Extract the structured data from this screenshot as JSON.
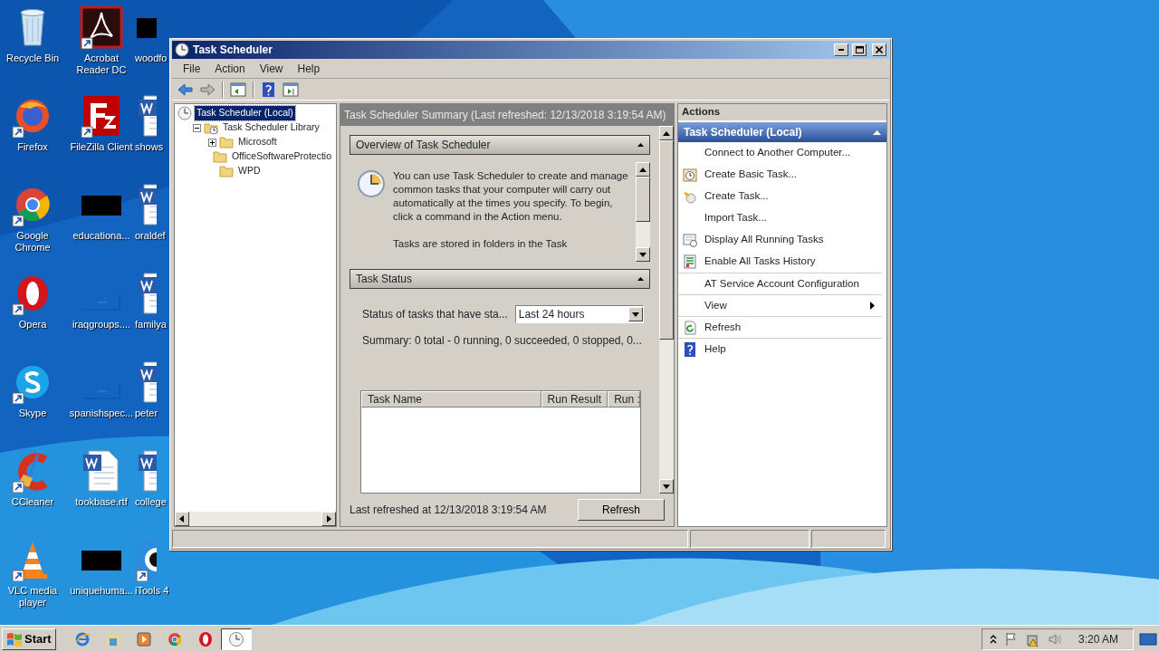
{
  "desktop_icons": [
    {
      "label": "Recycle Bin",
      "kind": "recycle-bin",
      "shortcut": false
    },
    {
      "label": "Firefox",
      "kind": "firefox",
      "shortcut": true
    },
    {
      "label": "Google Chrome",
      "kind": "chrome",
      "shortcut": true
    },
    {
      "label": "Opera",
      "kind": "opera",
      "shortcut": true
    },
    {
      "label": "Skype",
      "kind": "skype",
      "shortcut": true
    },
    {
      "label": "CCleaner",
      "kind": "ccleaner",
      "shortcut": true
    },
    {
      "label": "VLC media player",
      "kind": "vlc",
      "shortcut": true
    },
    {
      "label": "Acrobat Reader DC",
      "kind": "pdf",
      "shortcut": true
    },
    {
      "label": "FileZilla Client",
      "kind": "filezilla",
      "shortcut": true
    },
    {
      "label": "educationa...",
      "kind": "redacted",
      "shortcut": false
    },
    {
      "label": "iraqgroups....",
      "kind": "blank",
      "shortcut": false
    },
    {
      "label": "spanishspec...",
      "kind": "blank",
      "shortcut": false
    },
    {
      "label": "tookbase.rtf",
      "kind": "word",
      "shortcut": false
    },
    {
      "label": "uniquehuma...",
      "kind": "redacted",
      "shortcut": false
    },
    {
      "label": "woodfo",
      "kind": "redacted",
      "shortcut": false
    },
    {
      "label": "shows",
      "kind": "word",
      "shortcut": false
    },
    {
      "label": "oraldef",
      "kind": "word",
      "shortcut": false
    },
    {
      "label": "familya",
      "kind": "word",
      "shortcut": false
    },
    {
      "label": "peter",
      "kind": "word",
      "shortcut": false
    },
    {
      "label": "college",
      "kind": "word",
      "shortcut": false
    },
    {
      "label": "iTools 4",
      "kind": "itools",
      "shortcut": true
    }
  ],
  "window": {
    "title": "Task Scheduler",
    "menu": [
      "File",
      "Action",
      "View",
      "Help"
    ],
    "tree": [
      {
        "label": "Task Scheduler (Local)",
        "kind": "clock",
        "selected": true,
        "children": [
          {
            "label": "Task Scheduler Library",
            "kind": "folder-clock",
            "selected": false,
            "expanded": true,
            "children": [
              {
                "label": "Microsoft",
                "kind": "folder",
                "selected": false,
                "expanded": false,
                "has_children": true
              },
              {
                "label": "OfficeSoftwareProtectio",
                "kind": "folder",
                "selected": false
              },
              {
                "label": "WPD",
                "kind": "folder",
                "selected": false
              }
            ]
          }
        ]
      }
    ],
    "summary_header": "Task Scheduler Summary (Last refreshed: 12/13/2018 3:19:54 AM)",
    "overview": {
      "title": "Overview of Task Scheduler",
      "text": "You can use Task Scheduler to create and manage common tasks that your computer will carry out automatically at the times you specify. To begin, click a command in the Action menu.",
      "text_2": "Tasks are stored in folders in the Task"
    },
    "task_status": {
      "title": "Task Status",
      "filter_label": "Status of tasks that have sta...",
      "filter_value": "Last 24 hours",
      "summary": "Summary: 0 total - 0 running, 0 succeeded, 0 stopped, 0...",
      "columns": [
        "Task Name",
        "Run Result",
        "Run :"
      ]
    },
    "last_refreshed": "Last refreshed at 12/13/2018 3:19:54 AM",
    "refresh_button": "Refresh",
    "actions": {
      "title": "Actions",
      "group": "Task Scheduler (Local)",
      "items": [
        {
          "label": "Connect to Another Computer...",
          "kind": "plain",
          "divider_above": false,
          "submenu": false
        },
        {
          "label": "Create Basic Task...",
          "kind": "basic-task",
          "divider_above": false,
          "submenu": false
        },
        {
          "label": "Create Task...",
          "kind": "task",
          "divider_above": false,
          "submenu": false
        },
        {
          "label": "Import Task...",
          "kind": "plain",
          "divider_above": false,
          "submenu": false
        },
        {
          "label": "Display All Running Tasks",
          "kind": "running",
          "divider_above": false,
          "submenu": false
        },
        {
          "label": "Enable All Tasks History",
          "kind": "history",
          "divider_above": false,
          "submenu": false
        },
        {
          "label": "AT Service Account Configuration",
          "kind": "plain",
          "divider_above": true,
          "submenu": false
        },
        {
          "label": "View",
          "kind": "plain",
          "divider_above": true,
          "submenu": true
        },
        {
          "label": "Refresh",
          "kind": "refresh",
          "divider_above": true,
          "submenu": false
        },
        {
          "label": "Help",
          "kind": "help",
          "divider_above": true,
          "submenu": false
        }
      ]
    }
  },
  "taskbar": {
    "start": "Start",
    "apps": [
      {
        "kind": "ie",
        "selected": false
      },
      {
        "kind": "explorer",
        "selected": false
      },
      {
        "kind": "media",
        "selected": false
      },
      {
        "kind": "chrome",
        "selected": false
      },
      {
        "kind": "opera",
        "selected": false
      },
      {
        "kind": "clock",
        "selected": true
      }
    ],
    "clock": "3:20 AM"
  }
}
